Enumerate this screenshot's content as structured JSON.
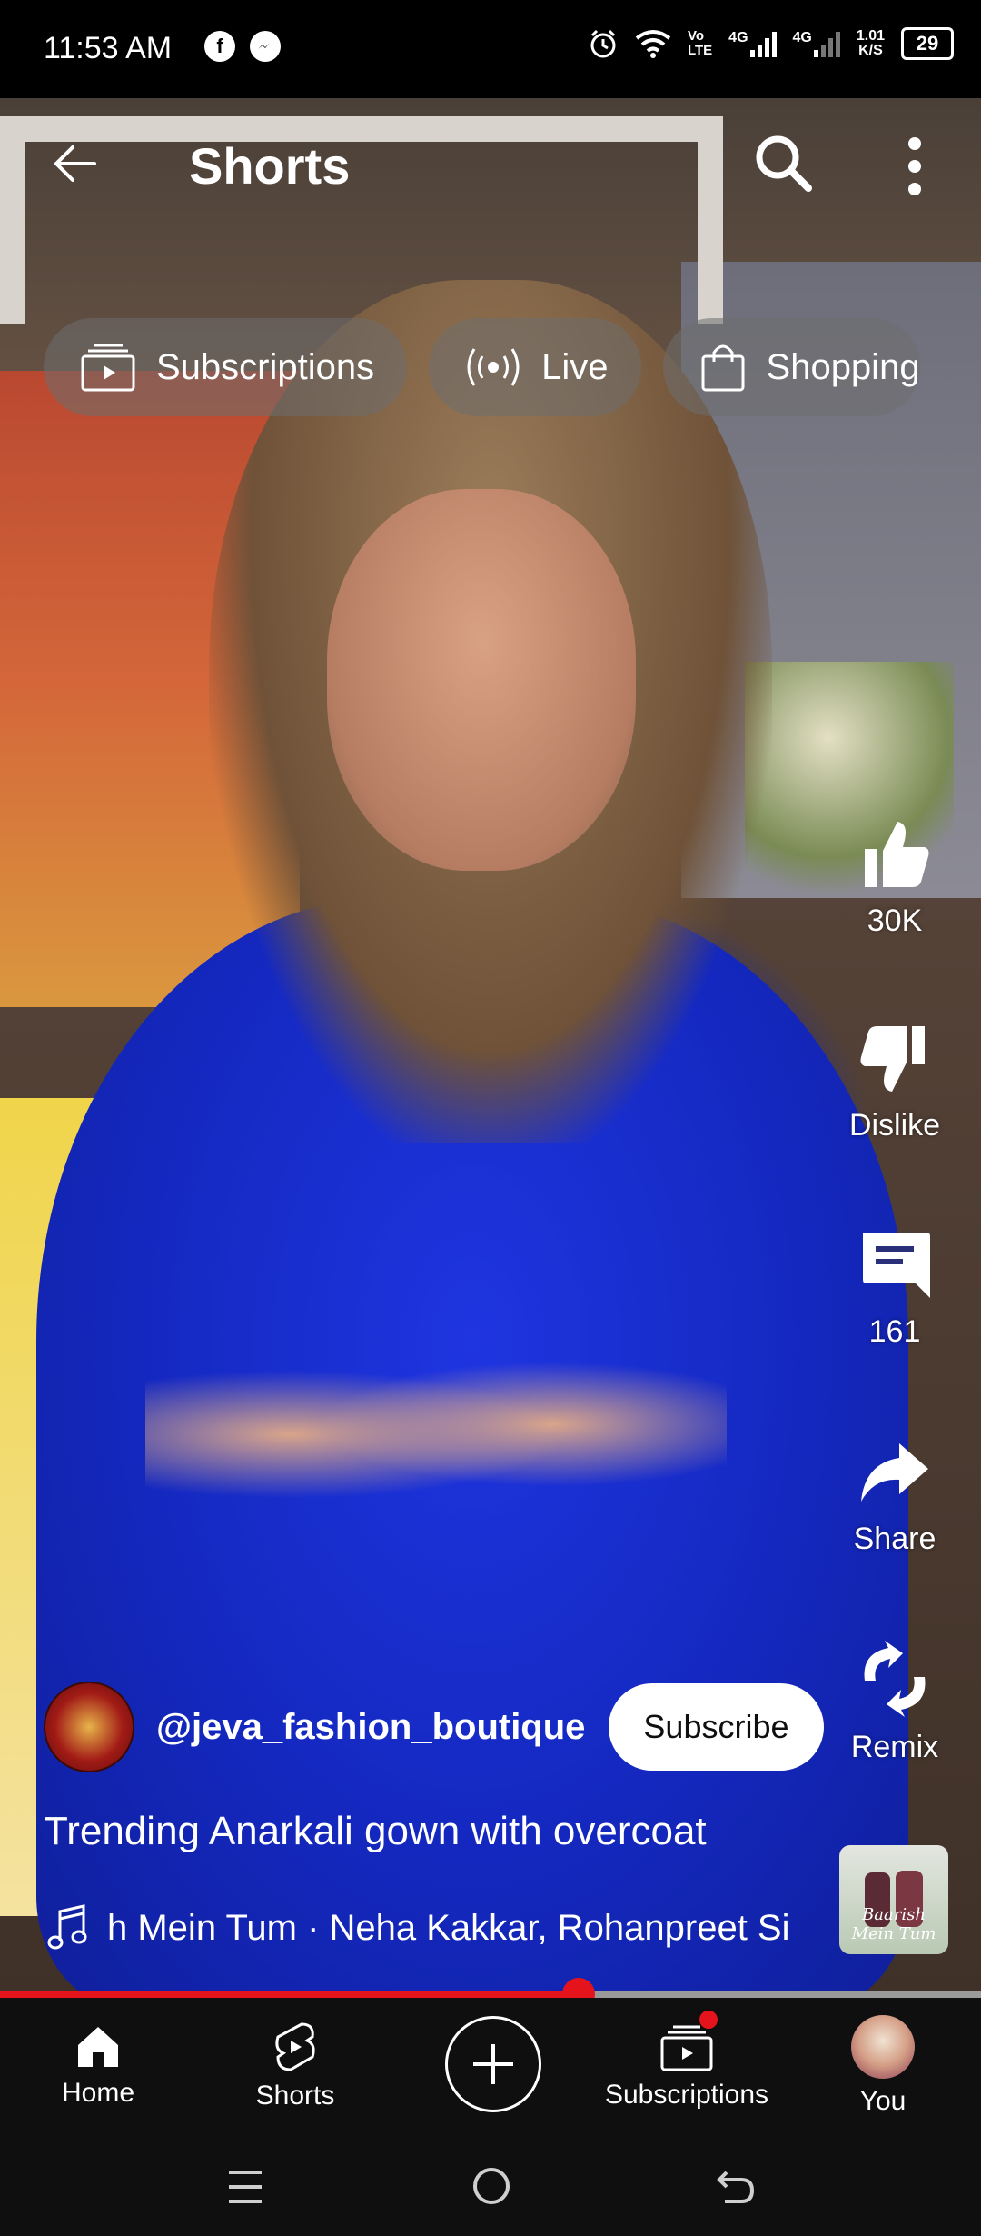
{
  "status_bar": {
    "time": "11:53 AM",
    "net_vo": "Vo",
    "net_lte": "LTE",
    "net_4g_1": "4G",
    "net_4g_2": "4G",
    "speed_value": "1.01",
    "speed_unit": "K/S",
    "battery": "29"
  },
  "header": {
    "title": "Shorts"
  },
  "chips": [
    {
      "label": "Subscriptions",
      "icon": "subscriptions-icon"
    },
    {
      "label": "Live",
      "icon": "live-icon"
    },
    {
      "label": "Shopping",
      "icon": "shopping-bag-icon"
    }
  ],
  "actions": {
    "like_count": "30K",
    "dislike_label": "Dislike",
    "comment_count": "161",
    "share_label": "Share",
    "remix_label": "Remix"
  },
  "video": {
    "channel_handle": "@jeva_fashion_boutique",
    "subscribe_label": "Subscribe",
    "caption": "Trending Anarkali gown with overcoat",
    "music_text": "h Mein Tum · Neha Kakkar, Rohanpreet Si",
    "thumbnail_title": "Baarish Mein Tum",
    "progress_fraction": 0.59
  },
  "bottom_nav": {
    "home": "Home",
    "shorts": "Shorts",
    "subscriptions": "Subscriptions",
    "you": "You"
  },
  "colors": {
    "accent": "#e5141c",
    "nav_bg": "#0f0f0f",
    "chip_bg": "rgba(110,110,110,0.55)"
  }
}
